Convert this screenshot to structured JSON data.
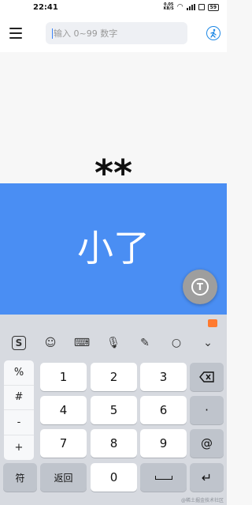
{
  "status_bar": {
    "time": "22:41",
    "net_speed": "0.05",
    "net_unit": "KB/S",
    "battery": "59"
  },
  "top_bar": {
    "search_placeholder": "输入 0~99 数字"
  },
  "display": {
    "masked_value": "**",
    "result": "小了"
  },
  "keyboard": {
    "symbols": [
      "%",
      "#",
      "-",
      "+"
    ],
    "rows": [
      [
        "1",
        "2",
        "3"
      ],
      [
        "4",
        "5",
        "6"
      ],
      [
        "7",
        "8",
        "9"
      ]
    ],
    "side_keys": [
      "·",
      "@"
    ],
    "bottom": {
      "symbol_key": "符",
      "back_key": "返回",
      "zero": "0"
    },
    "watermark": "@稀土掘金技术社区"
  },
  "colors": {
    "accent": "#4a8ef3",
    "fab": "#9e9e9e",
    "keyboard_bg": "#d7dae0"
  }
}
